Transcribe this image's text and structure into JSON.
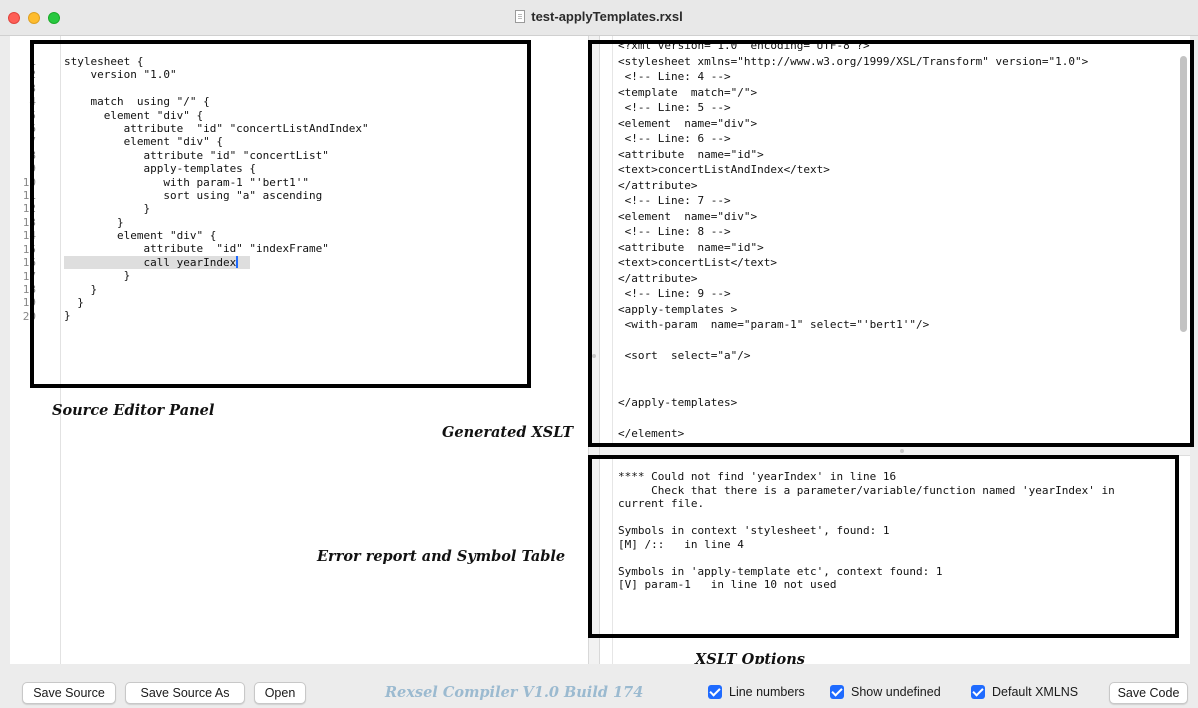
{
  "window": {
    "title": "test-applyTemplates.rxsl"
  },
  "editor": {
    "line_numbers": [
      "1",
      "2",
      "3",
      "4",
      "5",
      "6",
      "7",
      "8",
      "9",
      "10",
      "11",
      "12",
      "13",
      "14",
      "15",
      "16",
      "17",
      "18",
      "19",
      "20"
    ],
    "lines": [
      "stylesheet {",
      "    version \"1.0\"",
      "",
      "    match  using \"/\" {",
      "      element \"div\" {",
      "         attribute  \"id\" \"concertListAndIndex\"",
      "         element \"div\" {",
      "            attribute \"id\" \"concertList\"",
      "            apply-templates {",
      "               with param-1 \"'bert1'\"",
      "               sort using \"a\" ascending",
      "            }",
      "        }",
      "        element \"div\" {",
      "            attribute  \"id\" \"indexFrame\"",
      "            call yearIndex",
      "         }",
      "    }",
      "  }",
      "}"
    ],
    "highlighted_line_index": 15
  },
  "xslt": {
    "lines": [
      "<?xml version=\"1.0\" encoding=\"UTF-8\"?>",
      "<stylesheet xmlns=\"http://www.w3.org/1999/XSL/Transform\" version=\"1.0\">",
      " <!-- Line: 4 -->",
      "<template  match=\"/\">",
      " <!-- Line: 5 -->",
      "<element  name=\"div\">",
      " <!-- Line: 6 -->",
      "<attribute  name=\"id\">",
      "<text>concertListAndIndex</text>",
      "</attribute>",
      " <!-- Line: 7 -->",
      "<element  name=\"div\">",
      " <!-- Line: 8 -->",
      "<attribute  name=\"id\">",
      "<text>concertList</text>",
      "</attribute>",
      " <!-- Line: 9 -->",
      "<apply-templates >",
      " <with-param  name=\"param-1\" select=\"'bert1'\"/>",
      "",
      " <sort  select=\"a\"/>",
      "",
      "",
      "</apply-templates>",
      "",
      "</element>"
    ]
  },
  "errors": {
    "lines": [
      "**** Could not find 'yearIndex' in line 16",
      "     Check that there is a parameter/variable/function named 'yearIndex' in",
      "current file.",
      "",
      "Symbols in context 'stylesheet', found: 1",
      "[M] /::   in line 4",
      "",
      "Symbols in 'apply-template etc', context found: 1",
      "[V] param-1   in line 10 not used"
    ]
  },
  "captions": {
    "source_editor": "Source Editor Panel",
    "generated_xslt": "Generated XSLT",
    "error_report": "Error report and Symbol Table",
    "xslt_options": "XSLT Options"
  },
  "toolbar": {
    "save_source": "Save Source",
    "save_source_as": "Save Source As",
    "open": "Open",
    "brand": "Rexsel Compiler V1.0 Build 174",
    "line_numbers_label": "Line numbers",
    "line_numbers_checked": true,
    "show_undefined_label": "Show undefined",
    "show_undefined_checked": true,
    "default_xmlns_label": "Default XMLNS",
    "default_xmlns_checked": true,
    "save_code": "Save Code"
  },
  "colors": {
    "accent": "#1f6bff",
    "brand_text": "#9bbad0",
    "annotation_frame": "#000000",
    "current_line_highlight": "#dedede"
  }
}
